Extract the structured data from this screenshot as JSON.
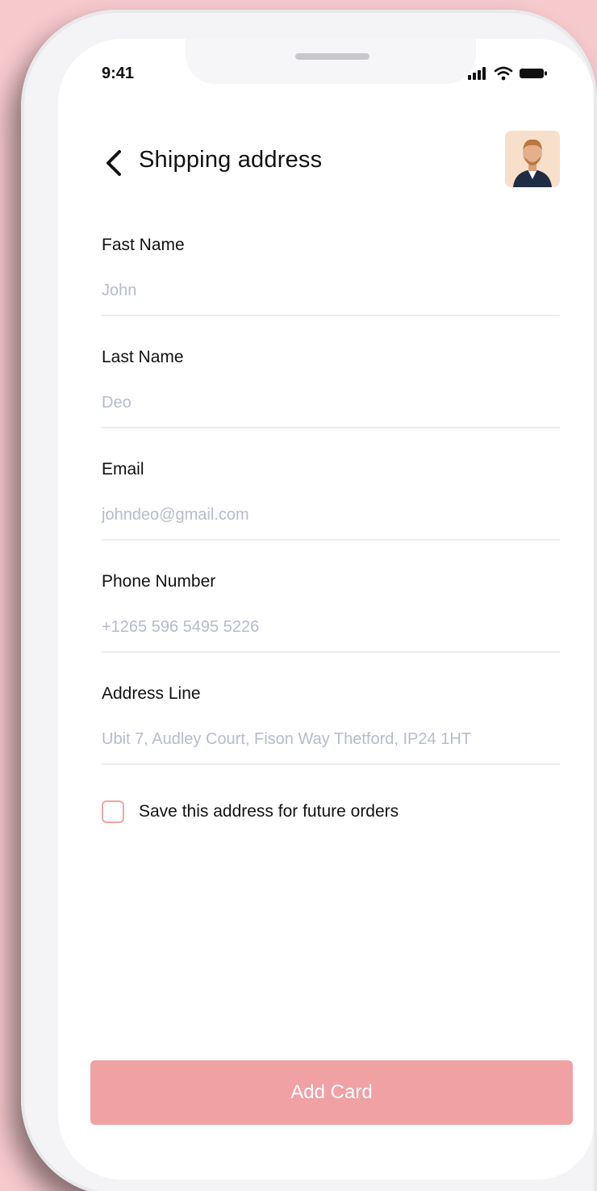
{
  "status_bar": {
    "time": "9:41",
    "icons": [
      "signal-icon",
      "wifi-icon",
      "battery-icon"
    ]
  },
  "header": {
    "title": "Shipping address",
    "back_icon": "chevron-left-icon",
    "avatar": "user-avatar"
  },
  "form": {
    "fields": [
      {
        "label": "Fast Name",
        "placeholder": "John"
      },
      {
        "label": "Last Name",
        "placeholder": "Deo"
      },
      {
        "label": "Email",
        "placeholder": "johndeo@gmail.com"
      },
      {
        "label": "Phone Number",
        "placeholder": "+1265 596 5495 5226"
      },
      {
        "label": "Address Line",
        "placeholder": "Ubit 7, Audley Court, Fison Way Thetford, IP24 1HT"
      }
    ],
    "save_label": "Save this address for future orders",
    "save_checked": false
  },
  "actions": {
    "primary_label": "Add Card"
  },
  "colors": {
    "background": "#f6c9cd",
    "accent": "#f0a1a4",
    "placeholder_text": "#b7bcca",
    "checkbox_border": "#f2a3a8"
  }
}
